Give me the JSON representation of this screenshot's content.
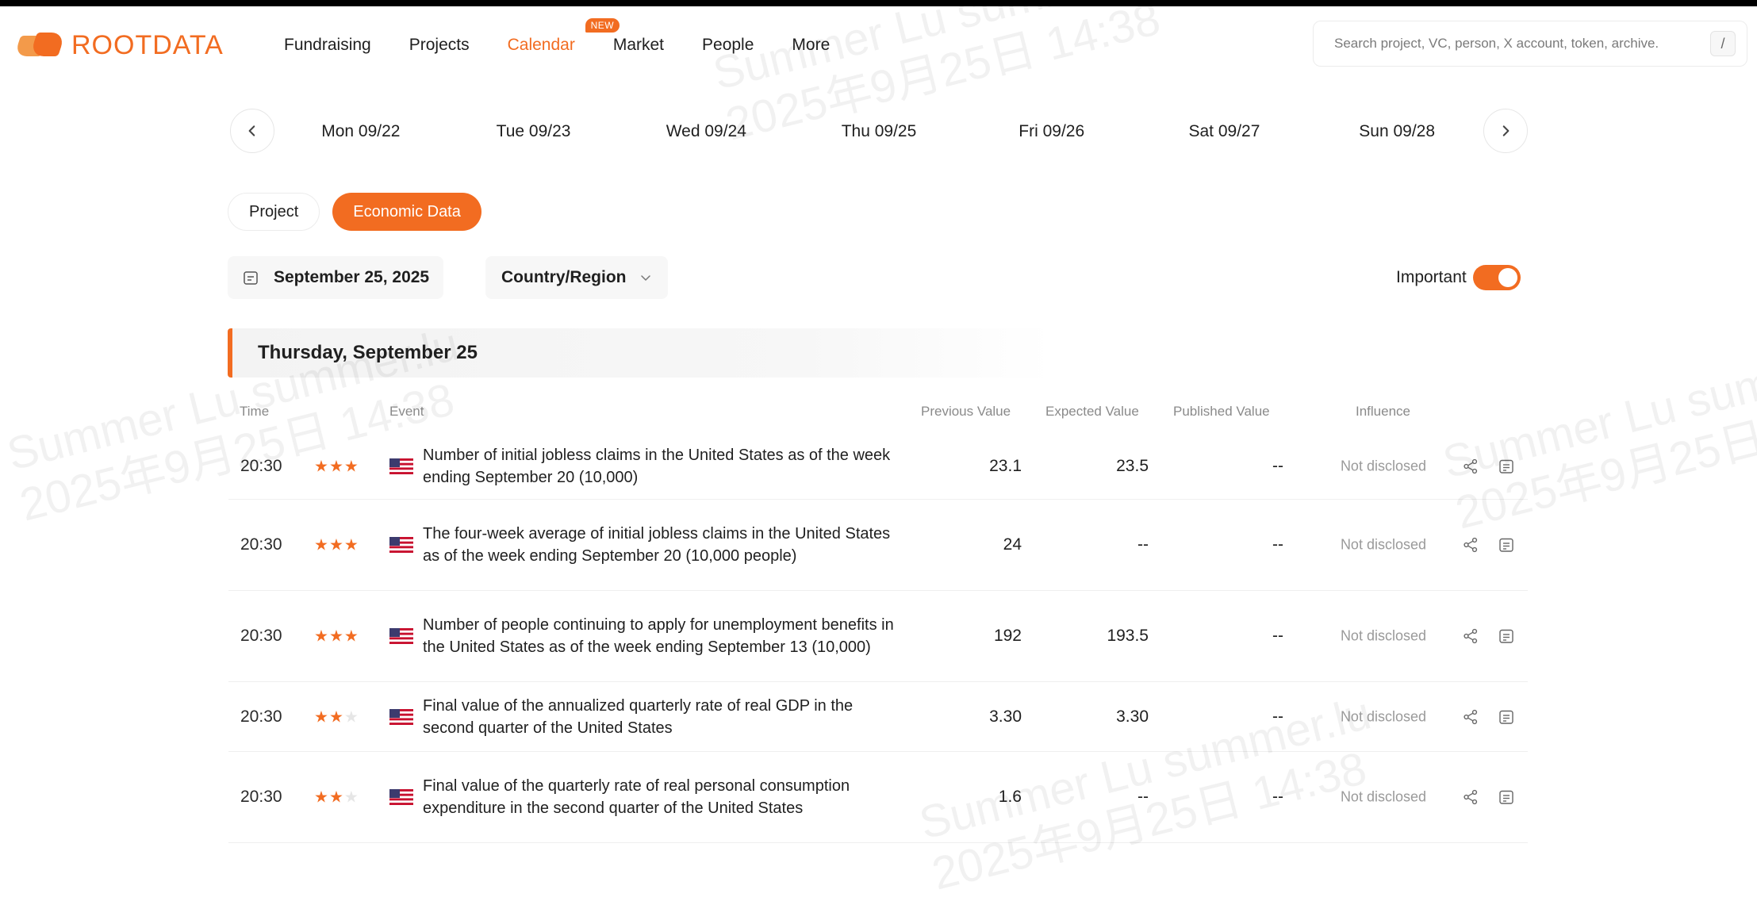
{
  "app": {
    "logo_text": "ROOTDATA"
  },
  "nav": {
    "items": [
      {
        "label": "Fundraising",
        "active": false
      },
      {
        "label": "Projects",
        "active": false
      },
      {
        "label": "Calendar",
        "active": true,
        "badge": "NEW"
      },
      {
        "label": "Market",
        "active": false
      },
      {
        "label": "People",
        "active": false
      },
      {
        "label": "More",
        "active": false
      }
    ]
  },
  "search": {
    "placeholder": "Search project, VC, person, X account, token, archive.",
    "shortcut": "/"
  },
  "date_strip": {
    "days": [
      "Mon 09/22",
      "Tue 09/23",
      "Wed 09/24",
      "Thu 09/25",
      "Fri 09/26",
      "Sat 09/27",
      "Sun 09/28"
    ]
  },
  "tabs": [
    {
      "label": "Project",
      "active": false
    },
    {
      "label": "Economic Data",
      "active": true
    }
  ],
  "filters": {
    "date": "September 25, 2025",
    "country": "Country/Region",
    "important_label": "Important",
    "important_on": true
  },
  "day_header": "Thursday, September 25",
  "table": {
    "columns": {
      "time": "Time",
      "event": "Event",
      "previous": "Previous Value",
      "expected": "Expected Value",
      "published": "Published Value",
      "influence": "Influence"
    },
    "rows": [
      {
        "time": "20:30",
        "stars": 3,
        "flag": "us-flag-icon",
        "event": "Number of initial jobless claims in the United States as of the week ending September 20 (10,000)",
        "previous": "23.1",
        "expected": "23.5",
        "published": "--",
        "influence": "Not disclosed"
      },
      {
        "time": "20:30",
        "stars": 3,
        "flag": "us-flag-icon",
        "event": "The four-week average of initial jobless claims in the United States as of the week ending September 20 (10,000 people)",
        "previous": "24",
        "expected": "--",
        "published": "--",
        "influence": "Not disclosed"
      },
      {
        "time": "20:30",
        "stars": 3,
        "flag": "us-flag-icon",
        "event": "Number of people continuing to apply for unemployment benefits in the United States as of the week ending September 13 (10,000)",
        "previous": "192",
        "expected": "193.5",
        "published": "--",
        "influence": "Not disclosed"
      },
      {
        "time": "20:30",
        "stars": 2,
        "flag": "us-flag-icon",
        "event": "Final value of the annualized quarterly rate of real GDP in the second quarter of the United States",
        "previous": "3.30",
        "expected": "3.30",
        "published": "--",
        "influence": "Not disclosed"
      },
      {
        "time": "20:30",
        "stars": 2,
        "flag": "us-flag-icon",
        "event": "Final value of the quarterly rate of real personal consumption expenditure in the second quarter of the United States",
        "previous": "1.6",
        "expected": "--",
        "published": "--",
        "influence": "Not disclosed"
      }
    ]
  },
  "watermark": {
    "line1": "Summer Lu summer.lu",
    "line2": "2025年9月25日 14:38"
  },
  "colors": {
    "accent": "#f26c21",
    "muted": "#8a8a8a"
  }
}
